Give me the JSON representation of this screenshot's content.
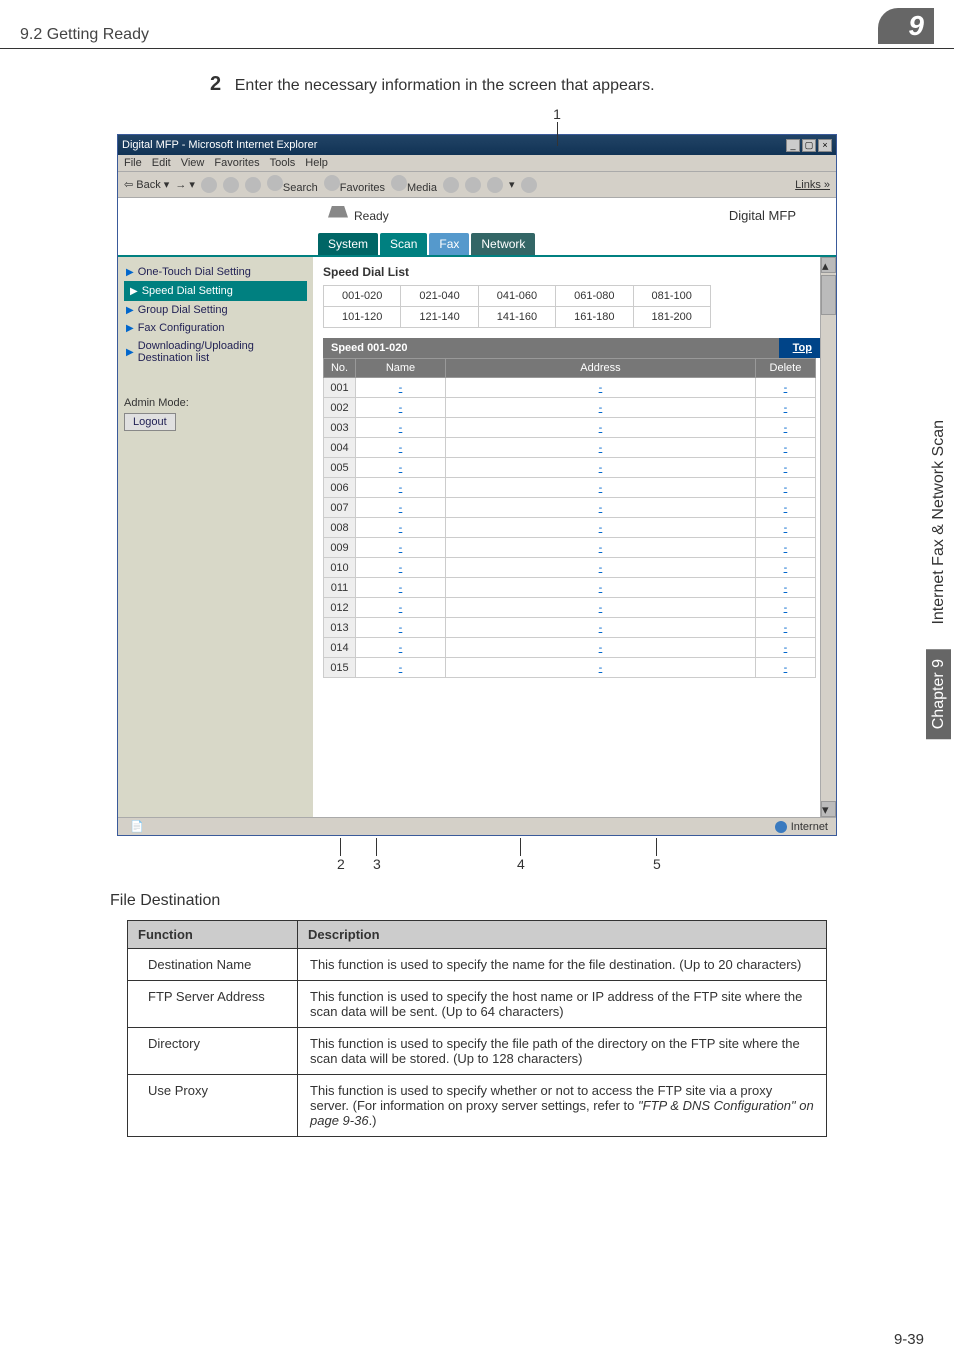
{
  "page": {
    "breadcrumb": "9.2 Getting Ready",
    "corner_num": "9",
    "footer_page": "9-39"
  },
  "side": {
    "chapter": "Chapter 9",
    "title": "Internet Fax & Network Scan"
  },
  "instruction": {
    "num": "2",
    "text": "Enter the necessary information in the screen that appears."
  },
  "callouts": {
    "top": "1",
    "bottom": [
      "2",
      "3",
      "4",
      "5"
    ]
  },
  "ie": {
    "title": "Digital MFP - Microsoft Internet Explorer",
    "menus": [
      "File",
      "Edit",
      "View",
      "Favorites",
      "Tools",
      "Help"
    ],
    "toolbar": {
      "back": "Back",
      "search": "Search",
      "favorites": "Favorites",
      "media": "Media",
      "links": "Links »"
    },
    "statusbar": "Internet"
  },
  "app": {
    "status": "Ready",
    "brand": "Digital MFP",
    "tabs": [
      "System",
      "Scan",
      "Fax",
      "Network"
    ],
    "active_tab_index": 1
  },
  "sidebar": {
    "items": [
      "One-Touch Dial Setting",
      "Speed Dial Setting",
      "Group Dial Setting",
      "Fax Configuration",
      "Downloading/Uploading Destination list"
    ],
    "selected_index": 1,
    "admin_label": "Admin Mode:",
    "logout": "Logout"
  },
  "main": {
    "list_title": "Speed Dial List",
    "pager_rows": [
      [
        "001-020",
        "021-040",
        "041-060",
        "061-080",
        "081-100"
      ],
      [
        "101-120",
        "121-140",
        "141-160",
        "161-180",
        "181-200"
      ]
    ],
    "speed_head": "Speed 001-020",
    "top_link": "Top",
    "columns": [
      "No.",
      "Name",
      "Address",
      "Delete"
    ],
    "rows": [
      {
        "no": "001",
        "name": "-",
        "addr": "-",
        "del": "-"
      },
      {
        "no": "002",
        "name": "-",
        "addr": "-",
        "del": "-"
      },
      {
        "no": "003",
        "name": "-",
        "addr": "-",
        "del": "-"
      },
      {
        "no": "004",
        "name": "-",
        "addr": "-",
        "del": "-"
      },
      {
        "no": "005",
        "name": "-",
        "addr": "-",
        "del": "-"
      },
      {
        "no": "006",
        "name": "-",
        "addr": "-",
        "del": "-"
      },
      {
        "no": "007",
        "name": "-",
        "addr": "-",
        "del": "-"
      },
      {
        "no": "008",
        "name": "-",
        "addr": "-",
        "del": "-"
      },
      {
        "no": "009",
        "name": "-",
        "addr": "-",
        "del": "-"
      },
      {
        "no": "010",
        "name": "-",
        "addr": "-",
        "del": "-"
      },
      {
        "no": "011",
        "name": "-",
        "addr": "-",
        "del": "-"
      },
      {
        "no": "012",
        "name": "-",
        "addr": "-",
        "del": "-"
      },
      {
        "no": "013",
        "name": "-",
        "addr": "-",
        "del": "-"
      },
      {
        "no": "014",
        "name": "-",
        "addr": "-",
        "del": "-"
      },
      {
        "no": "015",
        "name": "-",
        "addr": "-",
        "del": "-"
      }
    ]
  },
  "section_title": "File Destination",
  "functable": {
    "headers": [
      "Function",
      "Description"
    ],
    "rows": [
      {
        "fn": "Destination Name",
        "desc": "This function is used to specify the name for the file destination. (Up to 20 characters)"
      },
      {
        "fn": "FTP Server Address",
        "desc": "This function is used to specify the host name or IP address of the FTP site where the scan data will be sent. (Up to 64 characters)"
      },
      {
        "fn": "Directory",
        "desc": "This function is used to specify the file path of the directory on the FTP site where the scan data will be stored. (Up to 128 characters)"
      },
      {
        "fn": "Use Proxy",
        "desc_pre": "This function is used to specify whether or not to access the FTP site via a proxy server.  (For information on proxy server settings, refer to ",
        "desc_it": "\"FTP & DNS Configuration\" on page 9-36",
        "desc_post": ".)"
      }
    ]
  }
}
